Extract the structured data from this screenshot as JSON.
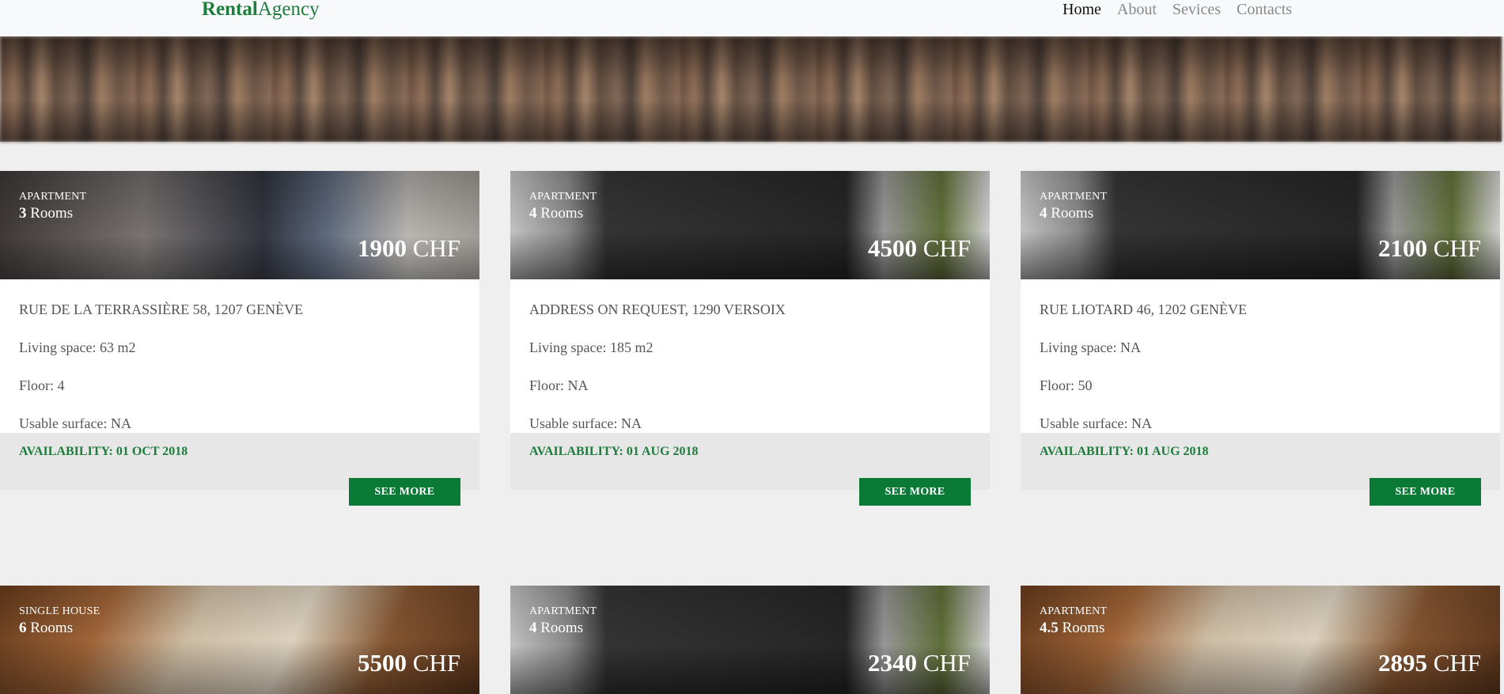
{
  "brand": {
    "bold": "Rental",
    "rest": "Agency"
  },
  "nav": {
    "home": "Home",
    "about": "About",
    "services": "Sevices",
    "contacts": "Contacts"
  },
  "cards": [
    {
      "type": "APARTMENT",
      "rooms_num": "3",
      "rooms_word": "Rooms",
      "price_num": "1900",
      "currency": "CHF",
      "address": "RUE DE LA TERRASSIÈRE 58, 1207 GENÈVE",
      "living": "Living space: 63 m2",
      "floor": "Floor: 4",
      "usable": "Usable surface: NA",
      "availability": "AVAILABILITY: 01 OCT 2018",
      "button": "SEE MORE"
    },
    {
      "type": "APARTMENT",
      "rooms_num": "4",
      "rooms_word": "Rooms",
      "price_num": "4500",
      "currency": "CHF",
      "address": "ADDRESS ON REQUEST, 1290 VERSOIX",
      "living": "Living space: 185 m2",
      "floor": "Floor: NA",
      "usable": "Usable surface: NA",
      "availability": "AVAILABILITY: 01 AUG 2018",
      "button": "SEE MORE"
    },
    {
      "type": "APARTMENT",
      "rooms_num": "4",
      "rooms_word": "Rooms",
      "price_num": "2100",
      "currency": "CHF",
      "address": "RUE LIOTARD 46, 1202 GENÈVE",
      "living": "Living space: NA",
      "floor": "Floor: 50",
      "usable": "Usable surface: NA",
      "availability": "AVAILABILITY: 01 AUG 2018",
      "button": "SEE MORE"
    },
    {
      "type": "SINGLE HOUSE",
      "rooms_num": "6",
      "rooms_word": "Rooms",
      "price_num": "5500",
      "currency": "CHF"
    },
    {
      "type": "APARTMENT",
      "rooms_num": "4",
      "rooms_word": "Rooms",
      "price_num": "2340",
      "currency": "CHF"
    },
    {
      "type": "APARTMENT",
      "rooms_num": "4.5",
      "rooms_word": "Rooms",
      "price_num": "2895",
      "currency": "CHF"
    }
  ]
}
